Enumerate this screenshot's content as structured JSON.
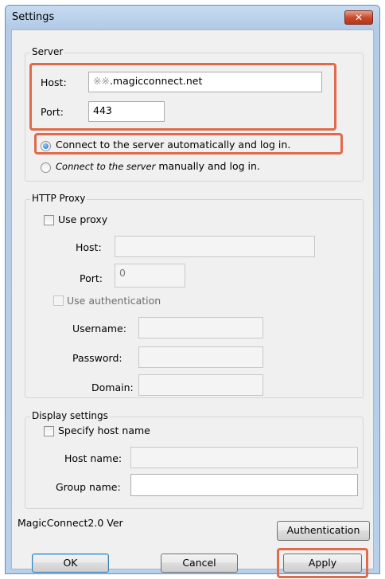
{
  "window": {
    "title": "Settings",
    "close_glyph": "✕"
  },
  "server": {
    "legend": "Server",
    "host_label": "Host:",
    "host_prefix": "※※",
    "host_value": ".magicconnect.net",
    "port_label": "Port:",
    "port_value": "443",
    "auto_prefix": "Connect to the server",
    "auto_suffix": " automatically and log in.",
    "manual_prefix": "Connect to the server",
    "manual_suffix": " manually and log in.",
    "auto_selected": true
  },
  "proxy": {
    "legend": "HTTP Proxy",
    "use_proxy_label": "Use proxy",
    "use_proxy_checked": false,
    "host_label": "Host:",
    "host_value": "",
    "port_label": "Port:",
    "port_value": "0",
    "use_auth_label": "Use authentication",
    "username_label": "Username:",
    "password_label": "Password:",
    "domain_label": "Domain:"
  },
  "display": {
    "legend": "Display settings",
    "specify_label": "Specify host name",
    "host_name_label": "Host name:",
    "group_name_label": "Group name:"
  },
  "footer": {
    "version": "MagicConnect2.0 Ver",
    "authentication_label": "Authentication",
    "ok_label": "OK",
    "cancel_label": "Cancel",
    "apply_label": "Apply"
  },
  "colors": {
    "highlight": "#e06a4a",
    "titlebar": "#b9d0ea",
    "close": "#c84a2c"
  }
}
